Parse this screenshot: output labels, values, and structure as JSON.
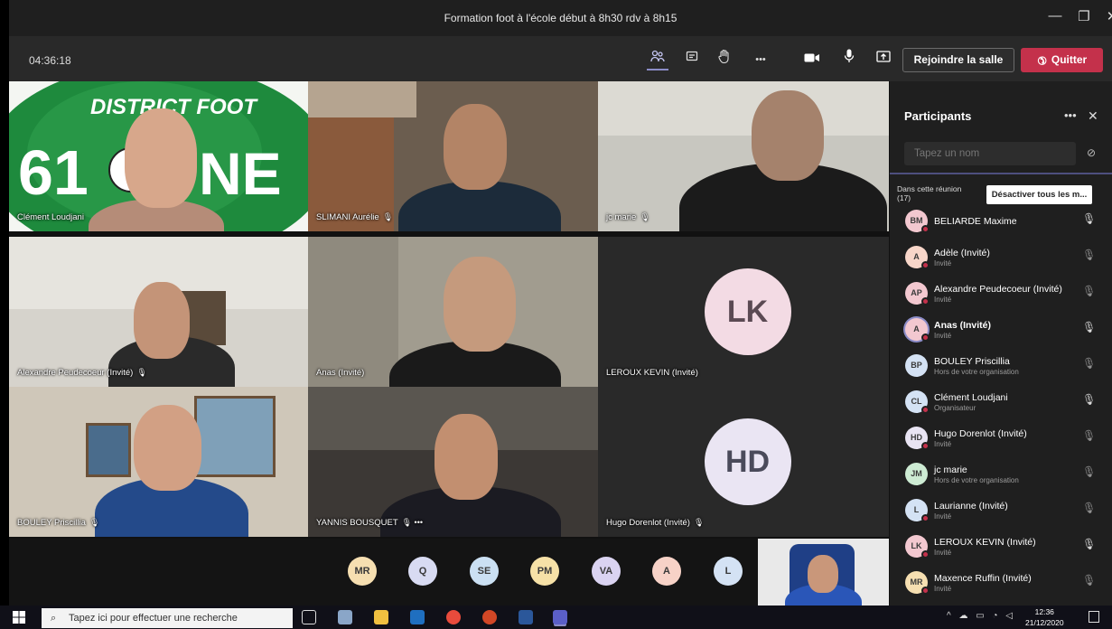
{
  "window": {
    "title": "Formation foot à l'école début à 8h30 rdv à 8h15",
    "minimize": "—",
    "maximize": "❐",
    "close": "✕"
  },
  "toolbar": {
    "timer": "04:36:18",
    "participants_icon": "people-icon",
    "chat_icon": "chat-icon",
    "hand_icon": "raise-hand-icon",
    "more": "•••",
    "join_room": "Rejoindre la salle",
    "quit": "Quitter"
  },
  "tiles": [
    {
      "name": "Clément Loudjani",
      "mic": ""
    },
    {
      "name": "SLIMANI Aurélie",
      "mic": "🎙"
    },
    {
      "name": "jc marie",
      "mic": "🎙"
    },
    {
      "name": "Alexandre Peudecoeur (Invité)",
      "mic": "🎙"
    },
    {
      "name": "Anas (Invité)",
      "mic": ""
    },
    {
      "name": "LEROUX KEVIN (Invité)",
      "mic": "",
      "initials": "LK"
    },
    {
      "name": "BOULEY Priscillia",
      "mic": "🎙"
    },
    {
      "name": "YANNIS BOUSQUET",
      "mic": "🎙 •••"
    },
    {
      "name": "Hugo Dorenlot (Invité)",
      "mic": "🎙",
      "initials": "HD"
    }
  ],
  "tile_logo_text": "DISTRICT FOOT",
  "overflow_avatars": [
    "MR",
    "Q",
    "SE",
    "PM",
    "VA",
    "A",
    "L"
  ],
  "panel": {
    "title": "Participants",
    "more": "•••",
    "close": "✕",
    "search_placeholder": "Tapez un nom",
    "section_label": "Dans cette réunion",
    "section_count": "(17)",
    "mute_all": "Désactiver tous les m...",
    "participants": [
      {
        "initials": "BM",
        "name": "BELIARDE Maxime",
        "sub": "",
        "mic": "🎙"
      },
      {
        "initials": "A",
        "name": "Adèle (Invité)",
        "sub": "Invité",
        "mic": "🎙"
      },
      {
        "initials": "AP",
        "name": "Alexandre Peudecoeur (Invité)",
        "sub": "Invité",
        "mic": "🎙"
      },
      {
        "initials": "A",
        "name": "Anas (Invité)",
        "sub": "Invité",
        "mic": "🎙"
      },
      {
        "initials": "BP",
        "name": "BOULEY Priscillia",
        "sub": "Hors de votre organisation",
        "mic": "🎙"
      },
      {
        "initials": "CL",
        "name": "Clément Loudjani",
        "sub": "Organisateur",
        "mic": "🎙"
      },
      {
        "initials": "HD",
        "name": "Hugo Dorenlot (Invité)",
        "sub": "Invité",
        "mic": "🎙"
      },
      {
        "initials": "JM",
        "name": "jc marie",
        "sub": "Hors de votre organisation",
        "mic": "🎙"
      },
      {
        "initials": "L",
        "name": "Laurianne (Invité)",
        "sub": "Invité",
        "mic": "🎙"
      },
      {
        "initials": "LK",
        "name": "LEROUX KEVIN (Invité)",
        "sub": "Invité",
        "mic": "🎙"
      },
      {
        "initials": "MR",
        "name": "Maxence Ruffin (Invité)",
        "sub": "Invité",
        "mic": "🎙"
      }
    ]
  },
  "taskbar": {
    "search_placeholder": "Tapez ici pour effectuer une recherche",
    "time": "12:36",
    "date": "21/12/2020"
  }
}
